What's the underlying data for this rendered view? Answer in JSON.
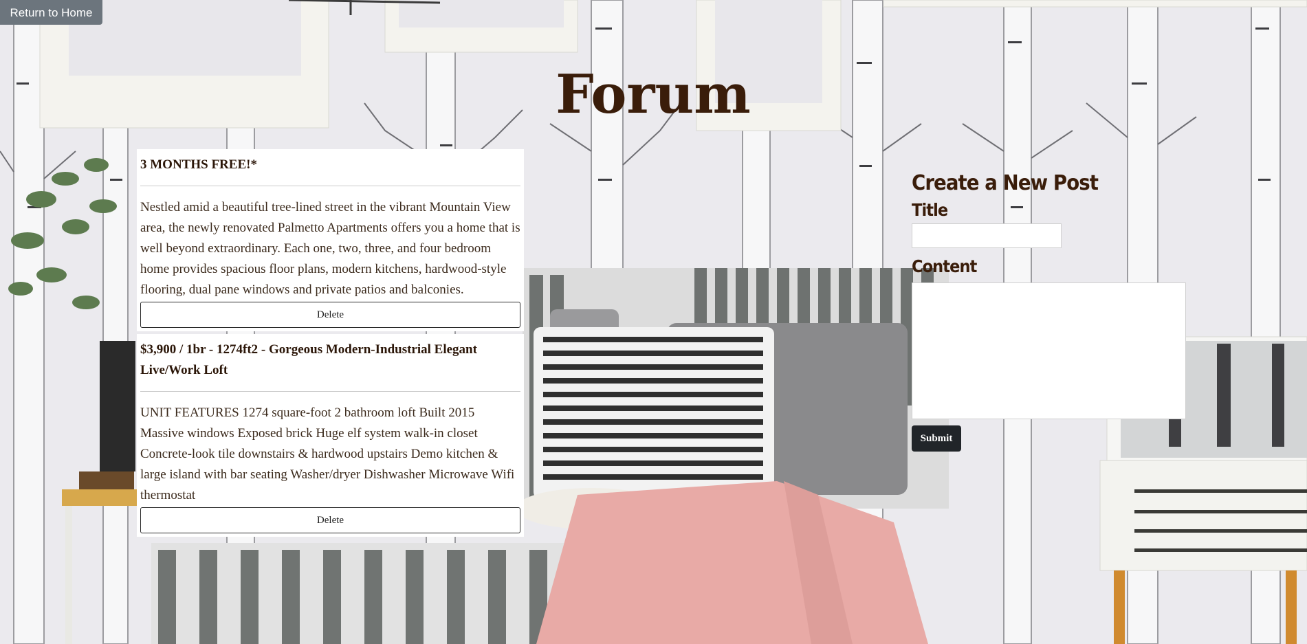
{
  "nav": {
    "return_label": "Return to Home"
  },
  "page": {
    "title": "Forum"
  },
  "posts": [
    {
      "title": "3 MONTHS FREE!*",
      "body": "Nestled amid a beautiful tree-lined street in the vibrant Mountain View area, the newly renovated Palmetto Apartments offers you a home that is well beyond extraordinary. Each one, two, three, and four bedroom home provides spacious floor plans, modern kitchens, hardwood-style flooring, dual pane windows and private patios and balconies.",
      "delete_label": "Delete"
    },
    {
      "title": "$3,900 / 1br - 1274ft2 - Gorgeous Modern-Industrial Elegant Live/Work Loft",
      "body": "UNIT FEATURES 1274 square-foot 2 bathroom loft Built 2015 Massive windows Exposed brick Huge elf system walk-in closet Concrete-look tile downstairs & hardwood upstairs Demo kitchen & large island with bar seating Washer/dryer Dishwasher Microwave Wifi thermostat",
      "delete_label": "Delete"
    }
  ],
  "new_post": {
    "heading": "Create a New Post",
    "title_label": "Title",
    "title_value": "",
    "content_label": "Content",
    "content_value": "",
    "submit_label": "Submit"
  },
  "colors": {
    "heading": "#3a1d0a",
    "home_button": "#6c757d",
    "submit_button": "#212529"
  }
}
